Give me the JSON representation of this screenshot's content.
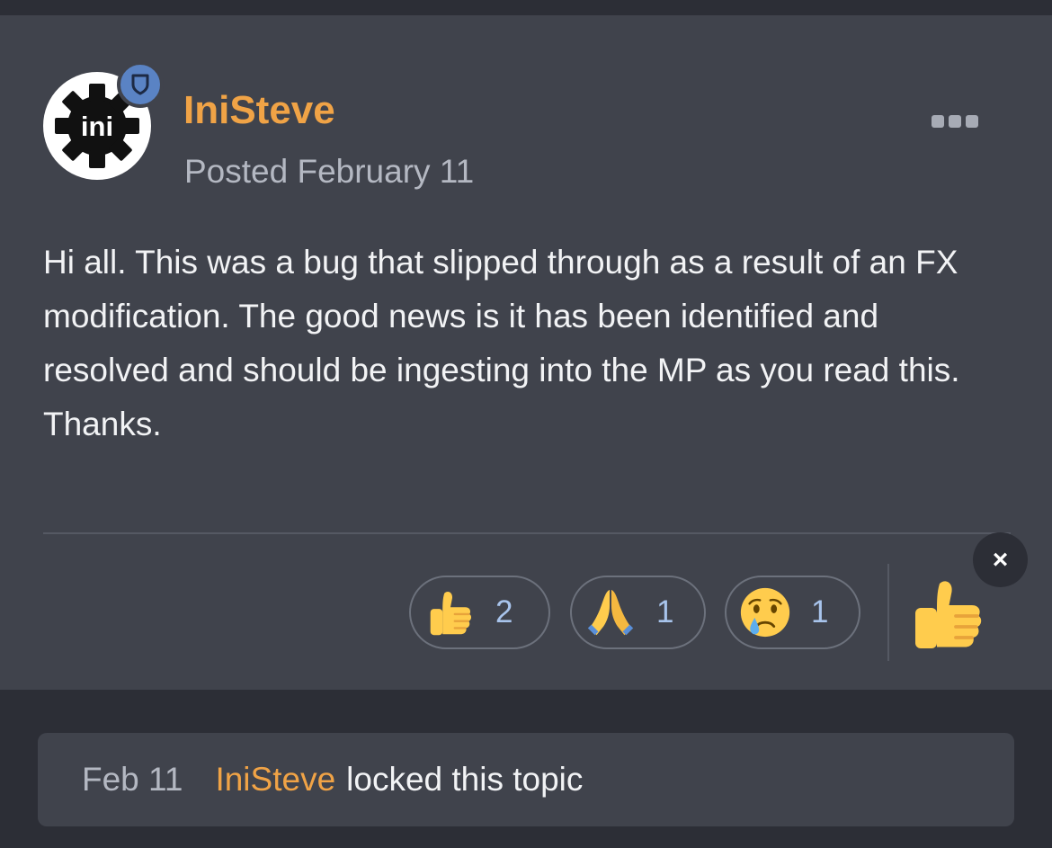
{
  "post": {
    "author": "IniSteve",
    "posted": "Posted February 11",
    "avatar_text": "ini",
    "body": "Hi all. This was a bug that slipped through as a result of an FX modification. The good news is it has been identified and resolved and should be ingesting into the MP as you read this. Thanks.",
    "reactions": [
      {
        "icon": "thumbs-up-emoji",
        "count": "2"
      },
      {
        "icon": "folded-hands-emoji",
        "count": "1"
      },
      {
        "icon": "crying-face-emoji",
        "count": "1"
      }
    ],
    "close_label": "×"
  },
  "activity": {
    "date": "Feb 11",
    "user": "IniSteve",
    "action": "locked this topic"
  },
  "colors": {
    "background": "#2c2e36",
    "card": "#40434c",
    "author": "#f0a346",
    "reaction_count": "#a8c4ec",
    "badge": "#5a83c4"
  }
}
